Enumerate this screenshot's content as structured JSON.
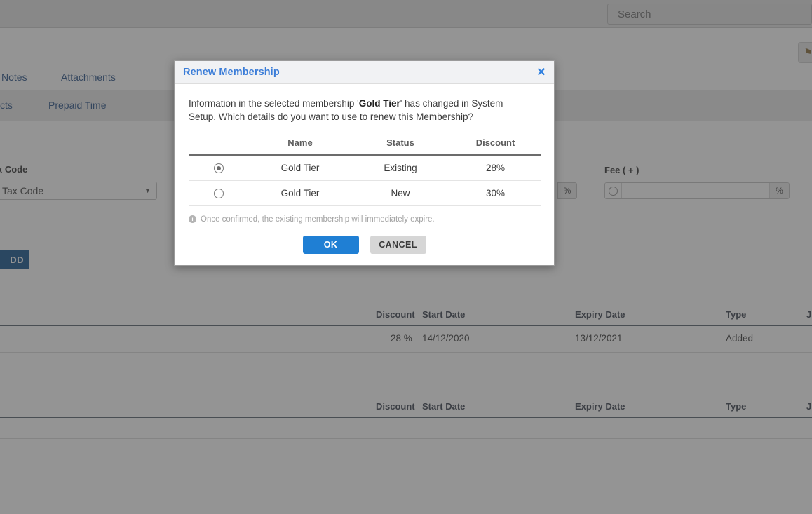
{
  "background": {
    "search": {
      "placeholder": "Search",
      "icon": "search-icon"
    },
    "corner_button_icon": "flag-icon",
    "tabs_row1": [
      {
        "label": "Notes",
        "x": 2
      },
      {
        "label": "Attachments",
        "x": 87
      }
    ],
    "tabs_row2": [
      {
        "label": "cts",
        "x": 0
      },
      {
        "label": "Prepaid Time",
        "x": 69
      }
    ],
    "tax_code": {
      "label": "x Code",
      "value": "art Tax Code",
      "caret_icon": "chevron-down-icon"
    },
    "fee_field": {
      "label": "Fee ( + )",
      "value": "",
      "suffix": "%",
      "radio_icon": "radio-icon"
    },
    "percent_chip": "%",
    "add_button": "DD",
    "grid_top": {
      "columns": [
        "Discount",
        "Start Date",
        "Expiry Date",
        "Type",
        "J"
      ],
      "rows": [
        {
          "discount": "28 %",
          "start_date": "14/12/2020",
          "expiry_date": "13/12/2021",
          "type": "Added",
          "j": ""
        }
      ]
    },
    "grid_bottom": {
      "columns": [
        "Discount",
        "Start Date",
        "Expiry Date",
        "Type",
        "J"
      ],
      "rows": []
    }
  },
  "dialog": {
    "title": "Renew Membership",
    "close_icon": "close-icon",
    "message_part1": "Information in the selected membership '",
    "message_bold": "Gold Tier",
    "message_part2": "' has changed in System Setup. Which details do you want to use to renew this Membership?",
    "table": {
      "headers": [
        "Name",
        "Status",
        "Discount"
      ],
      "rows": [
        {
          "selected": true,
          "name": "Gold Tier",
          "status": "Existing",
          "discount": "28%"
        },
        {
          "selected": false,
          "name": "Gold Tier",
          "status": "New",
          "discount": "30%"
        }
      ]
    },
    "note": "Once confirmed, the existing membership will immediately expire.",
    "note_icon": "info-icon",
    "ok_label": "OK",
    "cancel_label": "CANCEL"
  },
  "colors": {
    "accent_blue": "#3b7dd8",
    "ok_button": "#1f7fd4",
    "cancel_button": "#d6d6d6",
    "add_button": "#16548e",
    "tab_link": "#2a5287"
  }
}
